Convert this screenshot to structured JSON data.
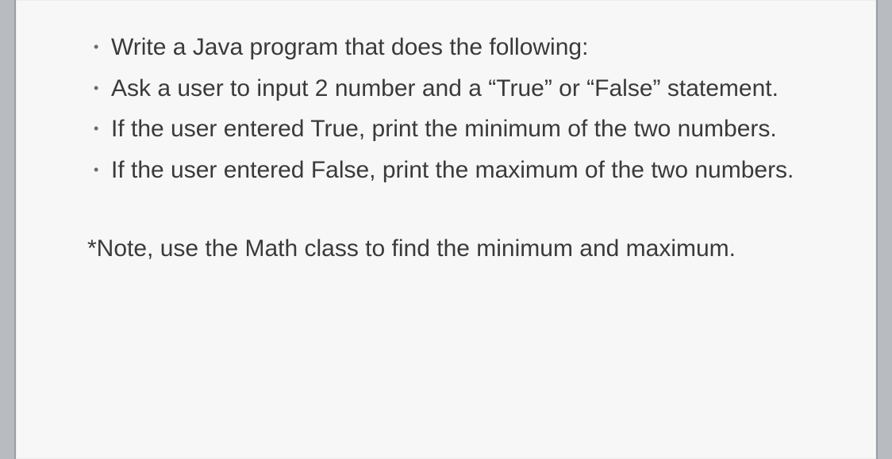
{
  "bullets": [
    "Write a Java program that does the following:",
    "Ask a user to input 2 number and a “True” or “False” statement.",
    "If the user entered True, print the minimum of the two numbers.",
    "If the user entered False, print the maximum of the two numbers."
  ],
  "note": "*Note, use the Math class to find the minimum and maximum."
}
